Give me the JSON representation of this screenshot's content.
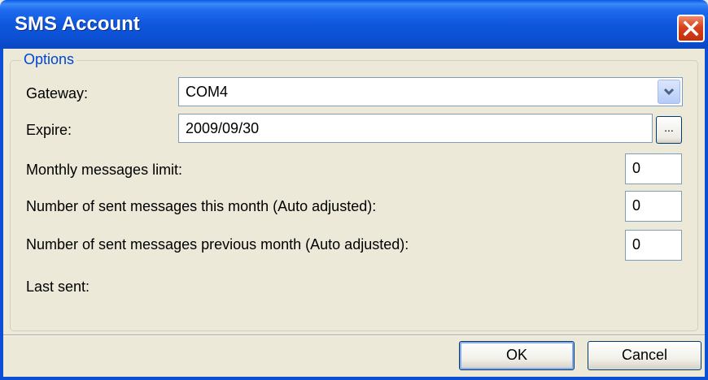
{
  "window": {
    "title": "SMS Account"
  },
  "options": {
    "legend": "Options",
    "gateway_label": "Gateway:",
    "gateway_value": "COM4",
    "expire_label": "Expire:",
    "expire_value": "2009/09/30",
    "browse_label": "...",
    "monthly_limit_label": "Monthly messages limit:",
    "monthly_limit_value": "0",
    "sent_this_month_label": "Number of sent messages this month (Auto adjusted):",
    "sent_this_month_value": "0",
    "sent_prev_month_label": "Number of sent messages previous month (Auto adjusted):",
    "sent_prev_month_value": "0",
    "last_sent_label": "Last sent:"
  },
  "buttons": {
    "ok": "OK",
    "cancel": "Cancel"
  },
  "icons": {
    "close": "close-icon",
    "dropdown": "chevron-down-icon"
  },
  "colors": {
    "titlebar": "#0a59e8",
    "close": "#d8421c",
    "legend": "#0046d5",
    "background": "#ece9d8"
  }
}
